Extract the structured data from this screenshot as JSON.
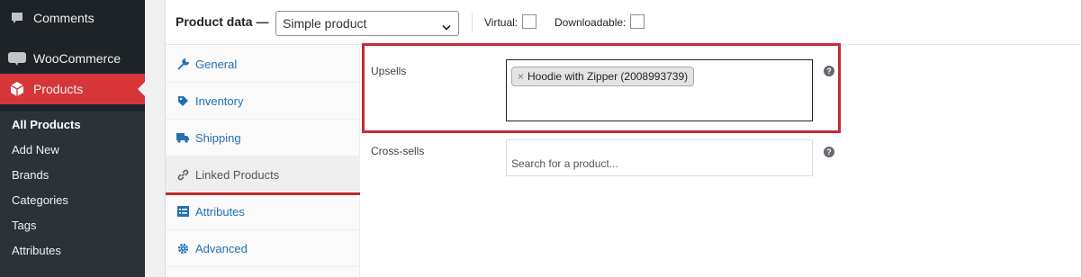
{
  "sidebar": {
    "menu": [
      {
        "label": "Comments",
        "icon": "comment-icon"
      },
      {
        "label": "WooCommerce",
        "icon": "woocommerce-icon",
        "badge": "woo"
      },
      {
        "label": "Products",
        "icon": "product-box-icon",
        "active": true
      }
    ],
    "submenu": [
      {
        "label": "All Products",
        "current": true
      },
      {
        "label": "Add New"
      },
      {
        "label": "Brands"
      },
      {
        "label": "Categories"
      },
      {
        "label": "Tags"
      },
      {
        "label": "Attributes"
      }
    ],
    "active_color": "#d63638"
  },
  "product_data": {
    "title": "Product data —",
    "type_select": {
      "value": "Simple product"
    },
    "virtual_label": "Virtual:",
    "downloadable_label": "Downloadable:",
    "tabs": [
      {
        "label": "General",
        "icon": "wrench-icon"
      },
      {
        "label": "Inventory",
        "icon": "tag-icon"
      },
      {
        "label": "Shipping",
        "icon": "truck-icon"
      },
      {
        "label": "Linked Products",
        "icon": "link-icon",
        "active": true
      },
      {
        "label": "Attributes",
        "icon": "list-icon"
      },
      {
        "label": "Advanced",
        "icon": "gear-icon"
      }
    ],
    "upsells": {
      "label": "Upsells",
      "selected": [
        "Hoodie with Zipper (2008993739)"
      ],
      "chip_remove": "×"
    },
    "cross_sells": {
      "label": "Cross-sells",
      "placeholder": "Search for a product..."
    },
    "help_glyph": "?",
    "highlight_color": "#c92a35"
  }
}
